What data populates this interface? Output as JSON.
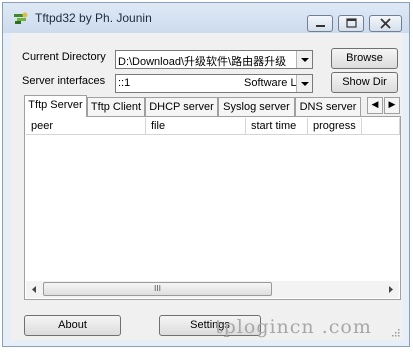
{
  "window": {
    "title": "Tftpd32 by Ph. Jounin",
    "controls": {
      "minimize": "minimize-icon",
      "maximize": "maximize-icon",
      "close": "close-icon"
    }
  },
  "fields": {
    "current_directory": {
      "label": "Current Directory",
      "value": "D:\\Download\\升级软件\\路由器升级"
    },
    "server_interfaces": {
      "label": "Server interfaces",
      "value": "::1",
      "value_suffix": "Software L"
    }
  },
  "buttons": {
    "browse": "Browse",
    "show_dir": "Show Dir",
    "about": "About",
    "settings": "Settings"
  },
  "tabs": [
    "Tftp Server",
    "Tftp Client",
    "DHCP server",
    "Syslog server",
    "DNS server"
  ],
  "active_tab": "Tftp Server",
  "table": {
    "columns": [
      "peer",
      "file",
      "start time",
      "progress"
    ],
    "rows": []
  },
  "scrollbar": {
    "thumb_glyph": "III"
  },
  "watermark": "tplogincn .com"
}
